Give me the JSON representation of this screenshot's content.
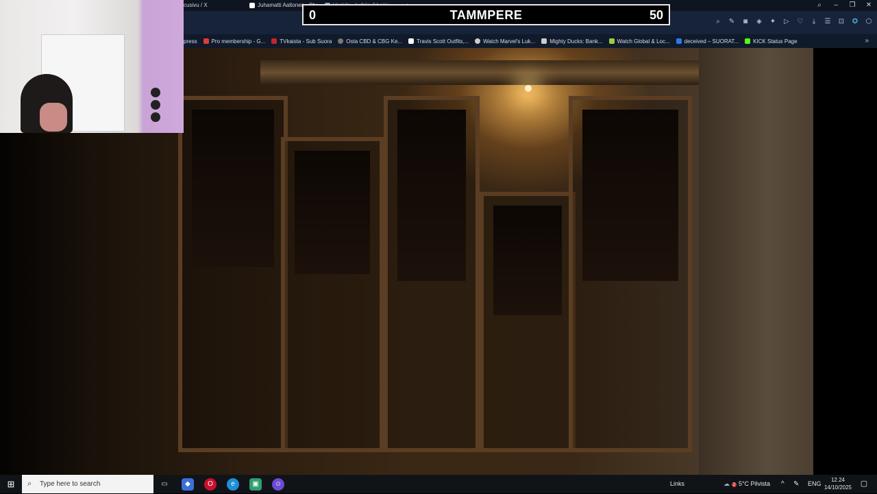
{
  "browser": {
    "tabs": [
      {
        "label": "cusivu / X",
        "icon": "x-logo-icon",
        "color": "#ffffff"
      },
      {
        "label": "Juhamatti Aaltonen - Stu",
        "icon": "patreon-icon",
        "color": "#ffffff"
      },
      {
        "label": "Vankila - kulkija 3d piirr...",
        "icon": "tab-favicon-icon",
        "color": "#8aa0c8"
      }
    ],
    "bookmarks": [
      {
        "label": "press",
        "icon": "bookmark-icon",
        "color": "#888888"
      },
      {
        "label": "Pro membership - G...",
        "icon": "map-pin-icon",
        "color": "#e23b3b"
      },
      {
        "label": "TVkaista - Sub Suora",
        "icon": "tv-icon",
        "color": "#c0262d"
      },
      {
        "label": "Osta CBD & CBG Ke...",
        "icon": "globe-icon",
        "color": "#777777"
      },
      {
        "label": "Travis Scott Outfits,...",
        "icon": "square-icon",
        "color": "#ffffff"
      },
      {
        "label": "Watch Marvel's Luk...",
        "icon": "swirl-icon",
        "color": "#cccccc"
      },
      {
        "label": "Mighty Ducks: Bank...",
        "icon": "tree-icon",
        "color": "#cccccc"
      },
      {
        "label": "Watch Global & Loc...",
        "icon": "android-icon",
        "color": "#9ccc44"
      },
      {
        "label": "deceived – SUORAT...",
        "icon": "square-blue-icon",
        "color": "#2d7be5"
      },
      {
        "label": "KICK Status Page",
        "icon": "kick-icon",
        "color": "#53fc18"
      }
    ]
  },
  "scoreboard": {
    "left_score": "0",
    "title": "TAMMPERE",
    "right_score": "50"
  },
  "taskbar": {
    "search_placeholder": "Type here to search",
    "links_label": "Links",
    "weather": "5°C  Pilvista",
    "language": "ENG",
    "time": "12.24",
    "date": "14/10/2025",
    "weather_badge": "2"
  }
}
